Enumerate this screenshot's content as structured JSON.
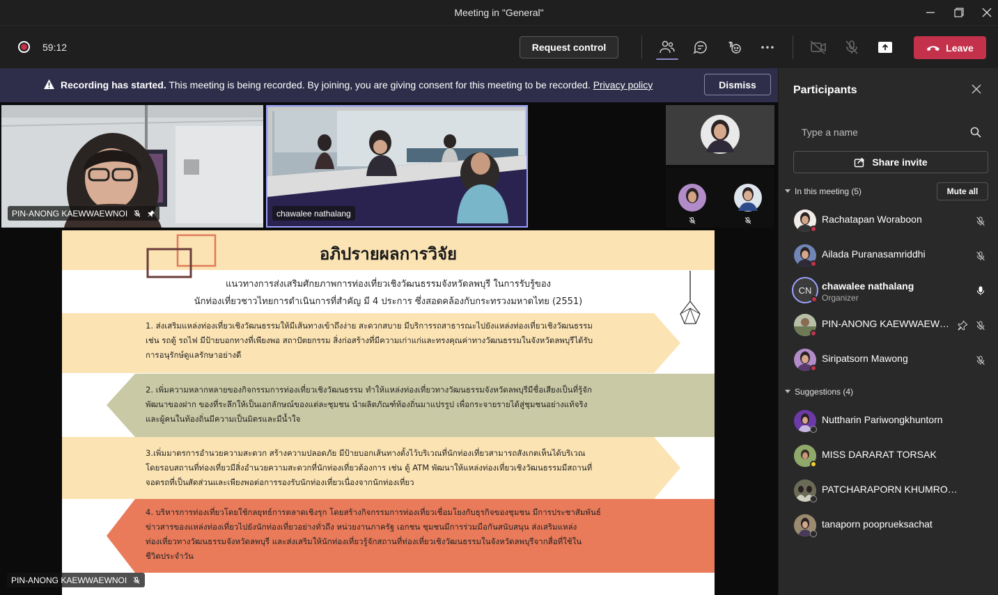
{
  "window": {
    "title": "Meeting in \"General\""
  },
  "toolbar": {
    "timer": "59:12",
    "request_control": "Request control",
    "leave": "Leave"
  },
  "banner": {
    "bold": "Recording has started.",
    "text": " This meeting is being recorded. By joining, you are giving consent for this meeting to be recorded. ",
    "link": "Privacy policy",
    "dismiss": "Dismiss"
  },
  "videos": {
    "tile1_name": "PIN-ANONG KAEWWAEWNOI",
    "tile2_name": "chawalee nathalang",
    "presenter_name": "PIN-ANONG KAEWWAEWNOI"
  },
  "slide": {
    "title": "อภิปรายผลการวิจัย",
    "intro_line1": "แนวทางการส่งเสริมศักยภาพการท่องเที่ยวเชิงวัฒนธรรมจังหวัดลพบุรี ในการรับรู้ของ",
    "intro_line2": "นักท่องเที่ยวชาวไทยการดำเนินการที่สำคัญ มี 4 ประการ ซึ่งสอดคล้องกับกระทรวงมหาดไทย (2551)",
    "items": [
      {
        "lines": [
          "1.  ส่งเสริมแหล่งท่องเที่ยวเชิงวัฒนธรรมให้มีเส้นทางเข้าถึงง่าย สะดวกสบาย มีบริการรถสาธารณะไปยังแหล่งท่องเที่ยวเชิงวัฒนธรรม",
          "เช่น รถตู้ รถไฟ มีป้ายบอกทางที่เพียงพอ สถาปัตยกรรม สิ่งก่อสร้างที่มีความเก่าแก่และทรงคุณค่าทางวัฒนธรรมในจังหวัดลพบุรีได้รับ",
          "การอนุรักษ์ดูแลรักษาอย่างดี"
        ]
      },
      {
        "lines": [
          "2.   เพิ่มความหลากหลายของกิจกรรมการท่องเที่ยวเชิงวัฒนธรรม ทำให้แหล่งท่องเที่ยวทางวัฒนธรรมจังหวัดลพบุรีมีชื่อเสียงเป็นที่รู้จัก",
          "พัฒนาของฝาก ของที่ระลึกให้เป็นเอกลักษณ์ของแต่ละชุมชน นำผลิตภัณฑ์ท้องถิ่นมาแปรรูป เพื่อกระจายรายได้สู่ชุมชนอย่างแท้จริง",
          "และผู้คนในท้องถิ่นมีความเป็นมิตรและมีน้ำใจ"
        ]
      },
      {
        "lines": [
          "3.เพิ่มมาตรการอำนวยความสะดวก สร้างความปลอดภัย มีป้ายบอกเส้นทางตั้งไว้บริเวณที่นักท่องเที่ยวสามารถสังเกตเห็นได้บริเวณ",
          "โดยรอบสถานที่ท่องเที่ยวมีสิ่งอำนวยความสะดวกที่นักท่องเที่ยวต้องการ เช่น ตู้ ATM พัฒนาให้แหล่งท่องเที่ยวเชิงวัฒนธรรมมีสถานที่",
          "จอดรถที่เป็นสัดส่วนและเพียงพอต่อการรองรับนักท่องเที่ยวเนื่องจากนักท่องเที่ยว"
        ]
      },
      {
        "lines": [
          "4. บริหารการท่องเที่ยวโดยใช้กลยุทธ์การตลาดเชิงรุก โดยสร้างกิจกรรมการท่องเที่ยวเชื่อมโยงกับธุรกิจของชุมชน มีการประชาสัมพันธ์",
          "ข่าวสารของแหล่งท่องเที่ยวไปยังนักท่องเที่ยวอย่างทั่วถึง หน่วยงานภาครัฐ เอกชน ชุมชนมีการร่วมมือกันสนับสนุน ส่งเสริมแหล่ง",
          "ท่องเที่ยวทางวัฒนธรรมจังหวัดลพบุรี และส่งเสริมให้นักท่องเที่ยวรู้จักสถานที่ท่องเที่ยวเชิงวัฒนธรรมในจังหวัดลพบุรีจากสื่อที่ใช้ใน",
          "ชีวิตประจำวัน"
        ]
      }
    ]
  },
  "panel": {
    "title": "Participants",
    "search_placeholder": "Type a name",
    "share_invite": "Share invite",
    "in_meeting_label": "In this meeting (5)",
    "mute_all": "Mute all",
    "suggestions_label": "Suggestions (4)",
    "in_meeting": [
      {
        "name": "Rachatapan Woraboon",
        "role": "",
        "status": "busy",
        "mic": "muted"
      },
      {
        "name": "Ailada Puranasamriddhi",
        "role": "",
        "status": "busy",
        "mic": "muted"
      },
      {
        "name": "chawalee nathalang",
        "role": "Organizer",
        "initials": "CN",
        "status": "busy",
        "mic": "on"
      },
      {
        "name": "PIN-ANONG KAEWWAEWN...",
        "role": "",
        "status": "busy",
        "mic": "muted",
        "pinned": true
      },
      {
        "name": "Siripatsorn Mawong",
        "role": "",
        "status": "busy",
        "mic": "muted"
      }
    ],
    "suggestions": [
      {
        "name": "Nuttharin Pariwongkhuntorn",
        "status": "offline"
      },
      {
        "name": "MISS DARARAT TORSAK",
        "status": "away"
      },
      {
        "name": "PATCHARAPORN KHUMROON",
        "status": "offline"
      },
      {
        "name": "tanaporn pooprueksachat",
        "status": "offline"
      }
    ]
  },
  "colors": {
    "accent": "#6264a7",
    "leave": "#c4314b",
    "banner": "#2f2e4a"
  }
}
